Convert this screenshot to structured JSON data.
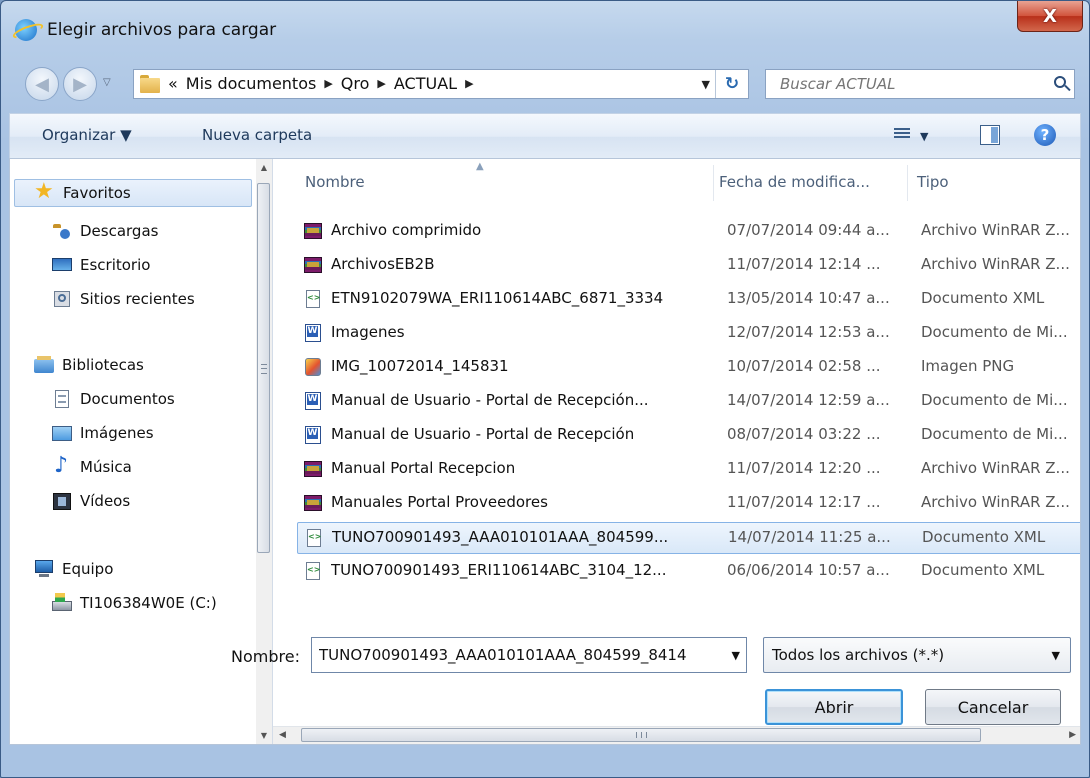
{
  "window": {
    "title": "Elegir archivos para cargar",
    "close_glyph": "X"
  },
  "nav": {
    "history_glyph": "▽",
    "breadcrumb_lead": "«",
    "breadcrumbs": [
      "Mis documentos",
      "Qro",
      "ACTUAL"
    ],
    "crumb_sep": "▶",
    "dropdown_glyph": "▼",
    "refresh_glyph": "↻",
    "search_placeholder": "Buscar ACTUAL"
  },
  "toolbar": {
    "organize": "Organizar ▼",
    "new_folder": "Nueva carpeta",
    "views_dropdown": "▼",
    "help": "?"
  },
  "sidebar": {
    "items": [
      {
        "label": "Favoritos",
        "icon": "star-icon"
      },
      {
        "label": "Descargas",
        "icon": "downloads-folder-icon"
      },
      {
        "label": "Escritorio",
        "icon": "desktop-icon"
      },
      {
        "label": "Sitios recientes",
        "icon": "recent-places-icon"
      },
      {
        "label": "Bibliotecas",
        "icon": "libraries-icon"
      },
      {
        "label": "Documentos",
        "icon": "documents-icon"
      },
      {
        "label": "Imágenes",
        "icon": "pictures-icon"
      },
      {
        "label": "Música",
        "icon": "music-icon"
      },
      {
        "label": "Vídeos",
        "icon": "videos-icon"
      },
      {
        "label": "Equipo",
        "icon": "computer-icon"
      },
      {
        "label": "TI106384W0E (C:)",
        "icon": "drive-icon"
      }
    ],
    "scroll_up": "▲",
    "scroll_down": "▼"
  },
  "columns": {
    "name": "Nombre",
    "date": "Fecha de modifica...",
    "type": "Tipo",
    "sort_glyph": "▲"
  },
  "files": [
    {
      "name": "Archivo comprimido",
      "date": "07/07/2014 09:44 a...",
      "type": "Archivo WinRAR Z...",
      "icon": "winrar-archive-icon"
    },
    {
      "name": "ArchivosEB2B",
      "date": "11/07/2014 12:14 ...",
      "type": "Archivo WinRAR Z...",
      "icon": "winrar-archive-icon"
    },
    {
      "name": "ETN9102079WA_ERI110614ABC_6871_3334",
      "date": "13/05/2014 10:47 a...",
      "type": "Documento XML",
      "icon": "xml-file-icon"
    },
    {
      "name": "Imagenes",
      "date": "12/07/2014 12:53 a...",
      "type": "Documento de Mi...",
      "icon": "word-document-icon"
    },
    {
      "name": "IMG_10072014_145831",
      "date": "10/07/2014 02:58 ...",
      "type": "Imagen PNG",
      "icon": "png-image-icon"
    },
    {
      "name": "Manual de Usuario - Portal de Recepción...",
      "date": "14/07/2014 12:59 a...",
      "type": "Documento de Mi...",
      "icon": "word-document-icon"
    },
    {
      "name": "Manual de Usuario - Portal de Recepción",
      "date": "08/07/2014 03:22 ...",
      "type": "Documento de Mi...",
      "icon": "word-document-icon"
    },
    {
      "name": "Manual Portal Recepcion",
      "date": "11/07/2014 12:20 ...",
      "type": "Archivo WinRAR Z...",
      "icon": "winrar-archive-icon"
    },
    {
      "name": "Manuales Portal Proveedores",
      "date": "11/07/2014 12:17 ...",
      "type": "Archivo WinRAR Z...",
      "icon": "winrar-archive-icon"
    },
    {
      "name": "TUNO700901493_AAA010101AAA_804599...",
      "date": "14/07/2014 11:25 a...",
      "type": "Documento XML",
      "icon": "xml-file-icon",
      "selected": true
    },
    {
      "name": "TUNO700901493_ERI110614ABC_3104_12...",
      "date": "06/06/2014 10:57 a...",
      "type": "Documento XML",
      "icon": "xml-file-icon"
    }
  ],
  "hscroll": {
    "left": "◀",
    "right": "▶",
    "grip": "III"
  },
  "footer": {
    "name_label": "Nombre:",
    "name_value": "TUNO700901493_AAA010101AAA_804599_8414",
    "name_dropdown": "▼",
    "filter_value": "Todos los archivos (*.*)",
    "filter_dropdown": "▼",
    "open_button": "Abrir",
    "cancel_button": "Cancelar"
  }
}
